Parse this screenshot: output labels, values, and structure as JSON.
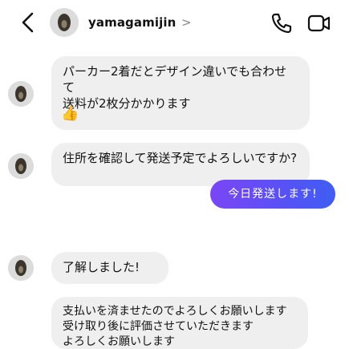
{
  "header": {
    "contact_name": "yamagamijin",
    "chevron": ">",
    "back_icon": "chevron-left-icon",
    "call_icon": "phone-icon",
    "video_icon": "video-camera-icon"
  },
  "messages": [
    {
      "sender": "contact",
      "text": "パーカー2着だとデザイン違いでも合わせて\n送料が2枚分かかります",
      "reaction": "👍"
    },
    {
      "sender": "contact",
      "text": "住所を確認して発送予定でよろしいですか?"
    },
    {
      "sender": "me",
      "text": "今日発送します!"
    },
    {
      "sender": "contact",
      "text": "了解しました!"
    },
    {
      "sender": "contact",
      "text": "支払いを済ませたのでよろしくお願いします\n受け取り後に評価させていただきます\nよろしくお願いします"
    }
  ],
  "colors": {
    "sent_bubble_start": "#7b46f5",
    "sent_bubble_end": "#3f5ef2",
    "received_bubble": "#efefef"
  }
}
